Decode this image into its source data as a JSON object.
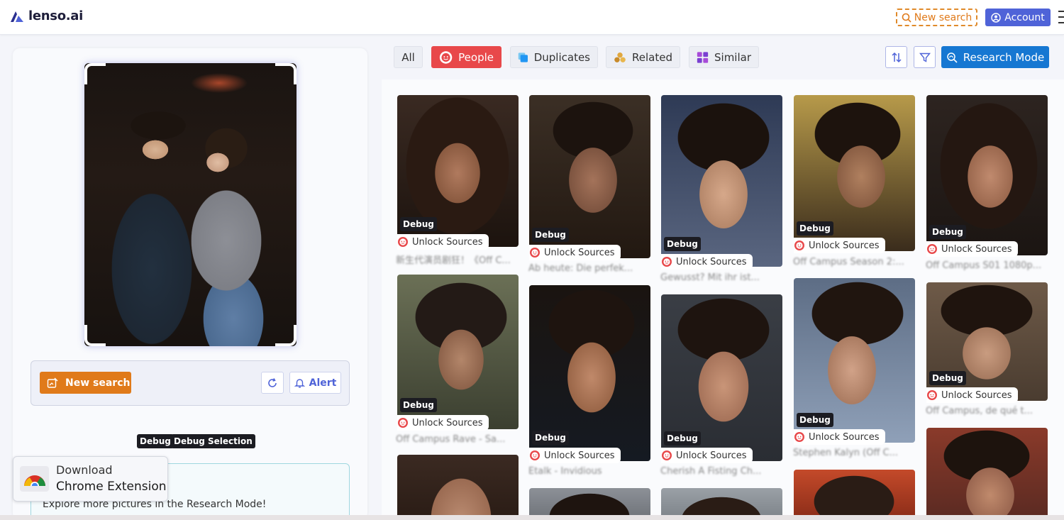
{
  "header": {
    "logo_text": "lenso.ai",
    "new_search_label": "New search",
    "account_label": "Account"
  },
  "left_panel": {
    "new_search_label": "New search",
    "alert_label": "Alert",
    "debug_labels": [
      "Debug",
      "Debug Selection"
    ],
    "research_text": "Explore more pictures in the Research Mode!",
    "chrome_ext": {
      "line1": "Download",
      "line2": "Chrome Extension"
    }
  },
  "filters": {
    "all": "All",
    "people": "People",
    "duplicates": "Duplicates",
    "related": "Related",
    "similar": "Similar",
    "research_mode": "Research Mode"
  },
  "result_common": {
    "debug_label": "Debug",
    "unlock_label": "Unlock Sources"
  },
  "results": [
    {
      "caption": "新生代演员剧狂！《Off C..."
    },
    {
      "caption": "Ab heute: Die perfek..."
    },
    {
      "caption": "Gewusst? Mit ihr ist..."
    },
    {
      "caption": "Off Campus Season 2:..."
    },
    {
      "caption": "Off Campus S01 1080p..."
    },
    {
      "caption": "Off Campus Rave - Sa..."
    },
    {
      "caption": "Etalk - Invidious"
    },
    {
      "caption": "Cherish A Fisting Ch..."
    },
    {
      "caption": "Stephen Kalyn (Off C..."
    },
    {
      "caption": "Off Campus, de qué t..."
    }
  ],
  "colors": {
    "accent_blue": "#4f63d8",
    "orange": "#e07a1a",
    "people_red": "#e8484a",
    "research_blue": "#1677d2"
  }
}
